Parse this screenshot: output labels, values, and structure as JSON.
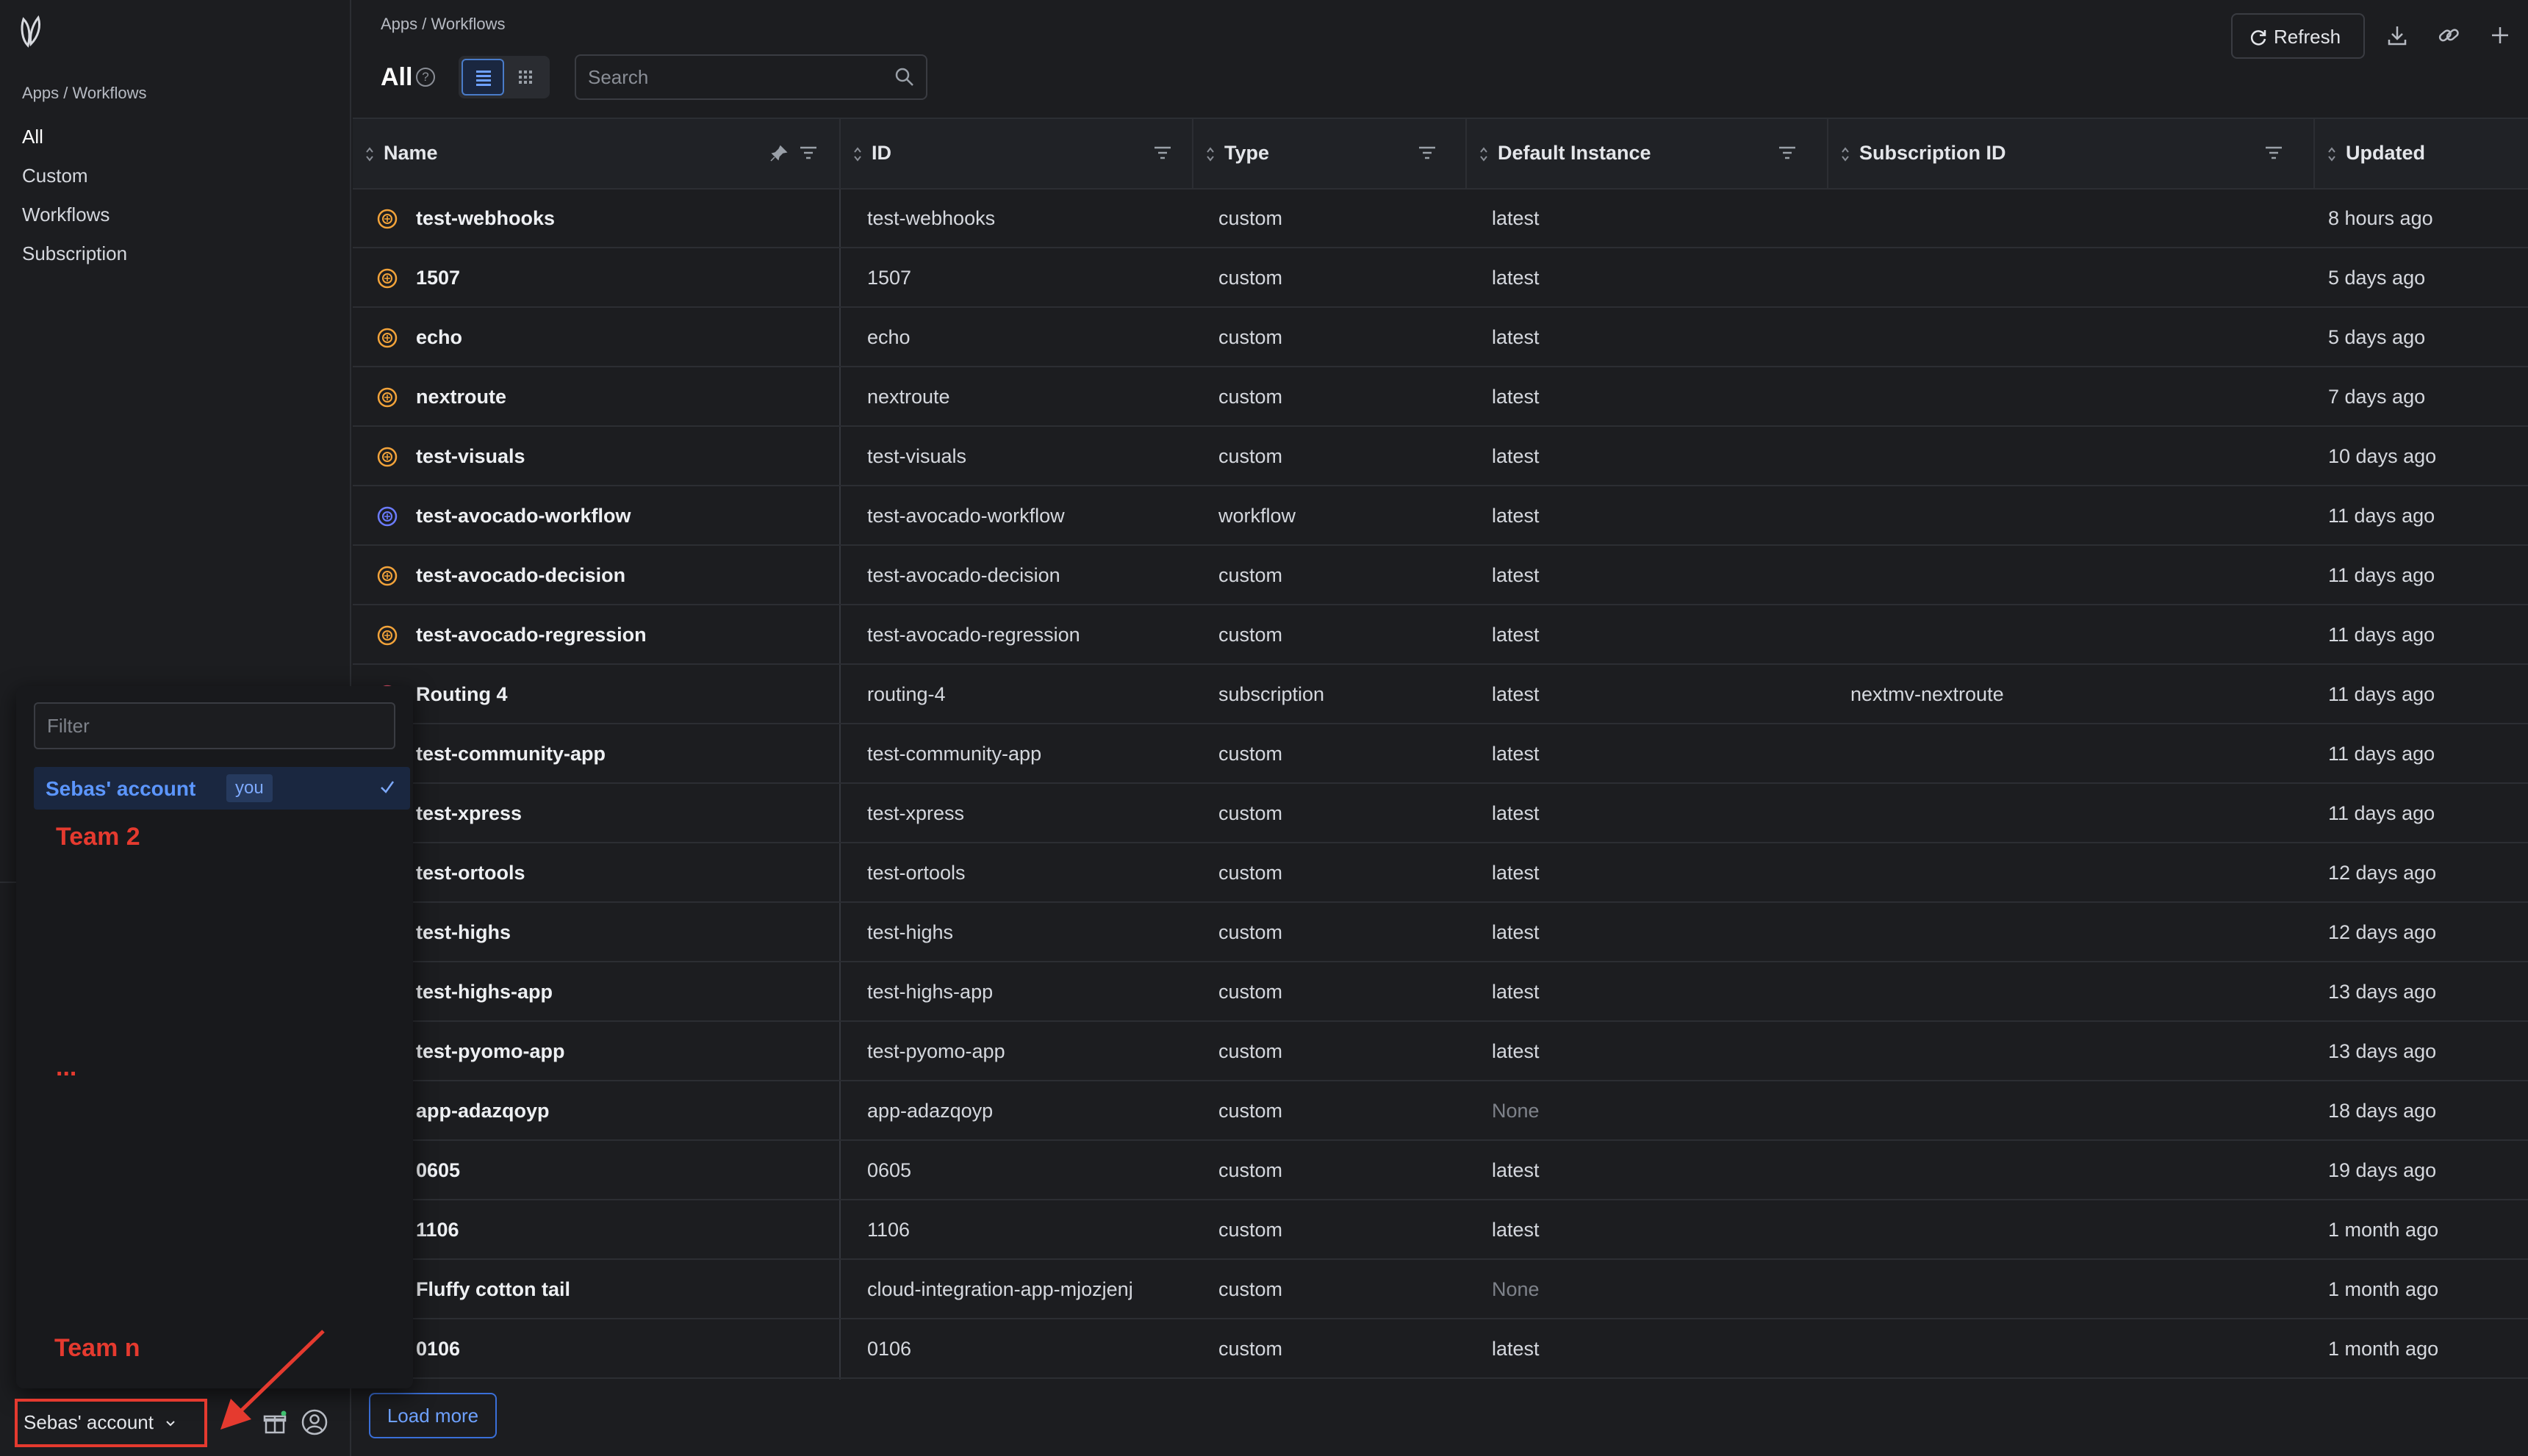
{
  "breadcrumb": "Apps / Workflows",
  "sidebar": {
    "breadcrumb": "Apps / Workflows",
    "items": [
      {
        "label": "All"
      },
      {
        "label": "Custom"
      },
      {
        "label": "Workflows"
      },
      {
        "label": "Subscription"
      }
    ]
  },
  "header": {
    "title": "All",
    "search_placeholder": "Search",
    "refresh_label": "Refresh"
  },
  "table": {
    "columns": [
      "Name",
      "ID",
      "Type",
      "Default Instance",
      "Subscription ID",
      "Updated"
    ],
    "rows": [
      {
        "name": "test-webhooks",
        "id": "test-webhooks",
        "type": "custom",
        "instance": "latest",
        "subscription": "",
        "updated": "8 hours ago",
        "icon": "custom-app-icon"
      },
      {
        "name": "1507",
        "id": "1507",
        "type": "custom",
        "instance": "latest",
        "subscription": "",
        "updated": "5 days ago",
        "icon": "custom-app-icon"
      },
      {
        "name": "echo",
        "id": "echo",
        "type": "custom",
        "instance": "latest",
        "subscription": "",
        "updated": "5 days ago",
        "icon": "custom-app-icon"
      },
      {
        "name": "nextroute",
        "id": "nextroute",
        "type": "custom",
        "instance": "latest",
        "subscription": "",
        "updated": "7 days ago",
        "icon": "custom-app-icon"
      },
      {
        "name": "test-visuals",
        "id": "test-visuals",
        "type": "custom",
        "instance": "latest",
        "subscription": "",
        "updated": "10 days ago",
        "icon": "custom-app-icon"
      },
      {
        "name": "test-avocado-workflow",
        "id": "test-avocado-workflow",
        "type": "workflow",
        "instance": "latest",
        "subscription": "",
        "updated": "11 days ago",
        "icon": "workflow-app-icon"
      },
      {
        "name": "test-avocado-decision",
        "id": "test-avocado-decision",
        "type": "custom",
        "instance": "latest",
        "subscription": "",
        "updated": "11 days ago",
        "icon": "custom-app-icon"
      },
      {
        "name": "test-avocado-regression",
        "id": "test-avocado-regression",
        "type": "custom",
        "instance": "latest",
        "subscription": "",
        "updated": "11 days ago",
        "icon": "custom-app-icon"
      },
      {
        "name": "Routing 4",
        "id": "routing-4",
        "type": "subscription",
        "instance": "latest",
        "subscription": "nextmv-nextroute",
        "updated": "11 days ago",
        "icon": "subscription-app-icon"
      },
      {
        "name": "test-community-app",
        "id": "test-community-app",
        "type": "custom",
        "instance": "latest",
        "subscription": "",
        "updated": "11 days ago",
        "icon": "custom-app-icon"
      },
      {
        "name": "test-xpress",
        "id": "test-xpress",
        "type": "custom",
        "instance": "latest",
        "subscription": "",
        "updated": "11 days ago",
        "icon": "custom-app-icon"
      },
      {
        "name": "test-ortools",
        "id": "test-ortools",
        "type": "custom",
        "instance": "latest",
        "subscription": "",
        "updated": "12 days ago",
        "icon": "custom-app-icon"
      },
      {
        "name": "test-highs",
        "id": "test-highs",
        "type": "custom",
        "instance": "latest",
        "subscription": "",
        "updated": "12 days ago",
        "icon": "custom-app-icon"
      },
      {
        "name": "test-highs-app",
        "id": "test-highs-app",
        "type": "custom",
        "instance": "latest",
        "subscription": "",
        "updated": "13 days ago",
        "icon": "custom-app-icon"
      },
      {
        "name": "test-pyomo-app",
        "id": "test-pyomo-app",
        "type": "custom",
        "instance": "latest",
        "subscription": "",
        "updated": "13 days ago",
        "icon": "custom-app-icon"
      },
      {
        "name": "app-adazqoyp",
        "id": "app-adazqoyp",
        "type": "custom",
        "instance": "None",
        "subscription": "",
        "updated": "18 days ago",
        "icon": "custom-app-icon"
      },
      {
        "name": "0605",
        "id": "0605",
        "type": "custom",
        "instance": "latest",
        "subscription": "",
        "updated": "19 days ago",
        "icon": "custom-app-icon"
      },
      {
        "name": "1106",
        "id": "1106",
        "type": "custom",
        "instance": "latest",
        "subscription": "",
        "updated": "1 month ago",
        "icon": "custom-app-icon"
      },
      {
        "name": "Fluffy cotton tail",
        "id": "cloud-integration-app-mjozjenj",
        "type": "custom",
        "instance": "None",
        "subscription": "",
        "updated": "1 month ago",
        "icon": "custom-app-icon"
      },
      {
        "name": "0106",
        "id": "0106",
        "type": "custom",
        "instance": "latest",
        "subscription": "",
        "updated": "1 month ago",
        "icon": "custom-app-icon"
      }
    ]
  },
  "footer": {
    "load_more_label": "Load more"
  },
  "account_menu": {
    "filter_placeholder": "Filter",
    "current_account": "Sebas' account",
    "you_badge": "you",
    "annotations": [
      "Team 2",
      "...",
      "Team n"
    ]
  },
  "account_switch": {
    "label": "Sebas' account"
  },
  "colors": {
    "accent": "#5c96ff",
    "annotation_red": "#e53a2f",
    "custom_icon": "#f2a33a",
    "workflow_icon": "#6b7cff",
    "subscription_icon": "#e0506a"
  }
}
